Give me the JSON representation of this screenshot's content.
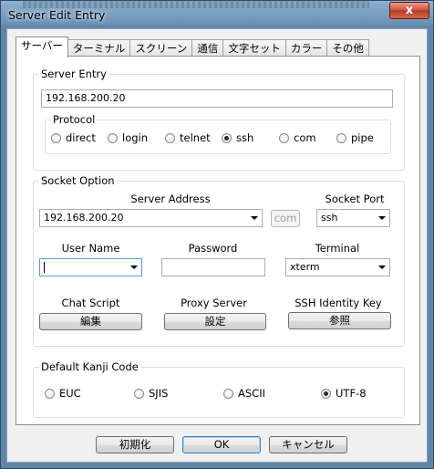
{
  "window": {
    "title": "Server Edit Entry",
    "close_glyph": "x"
  },
  "tabs": [
    {
      "label": "サーバー"
    },
    {
      "label": "ターミナル"
    },
    {
      "label": "スクリーン"
    },
    {
      "label": "通信"
    },
    {
      "label": "文字セット"
    },
    {
      "label": "カラー"
    },
    {
      "label": "その他"
    }
  ],
  "server_entry": {
    "legend": "Server Entry",
    "host_value": "192.168.200.20",
    "protocol": {
      "legend": "Protocol",
      "options": [
        {
          "label": "direct",
          "checked": false
        },
        {
          "label": "login",
          "checked": false
        },
        {
          "label": "telnet",
          "checked": false
        },
        {
          "label": "ssh",
          "checked": true
        },
        {
          "label": "com",
          "checked": false
        },
        {
          "label": "pipe",
          "checked": false
        }
      ]
    }
  },
  "socket_option": {
    "legend": "Socket Option",
    "server_address_label": "Server Address",
    "server_address_value": "192.168.200.20",
    "com_button": "com",
    "socket_port_label": "Socket Port",
    "socket_port_value": "ssh",
    "user_name_label": "User Name",
    "user_name_value": "",
    "password_label": "Password",
    "password_value": "",
    "terminal_label": "Terminal",
    "terminal_value": "xterm",
    "chat_script_label": "Chat Script",
    "chat_script_button": "編集",
    "proxy_server_label": "Proxy Server",
    "proxy_server_button": "設定",
    "ssh_identity_label": "SSH Identity Key",
    "ssh_identity_button": "参照"
  },
  "kanji": {
    "legend": "Default Kanji Code",
    "options": [
      {
        "label": "EUC",
        "checked": false
      },
      {
        "label": "SJIS",
        "checked": false
      },
      {
        "label": "ASCII",
        "checked": false
      },
      {
        "label": "UTF-8",
        "checked": true
      }
    ]
  },
  "footer": {
    "reset": "初期化",
    "ok": "OK",
    "cancel": "キャンセル"
  }
}
